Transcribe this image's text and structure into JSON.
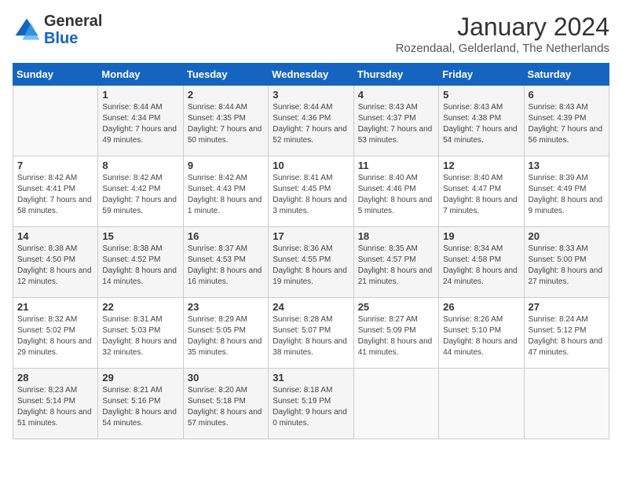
{
  "logo": {
    "general": "General",
    "blue": "Blue"
  },
  "header": {
    "month": "January 2024",
    "location": "Rozendaal, Gelderland, The Netherlands"
  },
  "days_of_week": [
    "Sunday",
    "Monday",
    "Tuesday",
    "Wednesday",
    "Thursday",
    "Friday",
    "Saturday"
  ],
  "weeks": [
    [
      {
        "day": "",
        "sunrise": "",
        "sunset": "",
        "daylight": ""
      },
      {
        "day": "1",
        "sunrise": "Sunrise: 8:44 AM",
        "sunset": "Sunset: 4:34 PM",
        "daylight": "Daylight: 7 hours and 49 minutes."
      },
      {
        "day": "2",
        "sunrise": "Sunrise: 8:44 AM",
        "sunset": "Sunset: 4:35 PM",
        "daylight": "Daylight: 7 hours and 50 minutes."
      },
      {
        "day": "3",
        "sunrise": "Sunrise: 8:44 AM",
        "sunset": "Sunset: 4:36 PM",
        "daylight": "Daylight: 7 hours and 52 minutes."
      },
      {
        "day": "4",
        "sunrise": "Sunrise: 8:43 AM",
        "sunset": "Sunset: 4:37 PM",
        "daylight": "Daylight: 7 hours and 53 minutes."
      },
      {
        "day": "5",
        "sunrise": "Sunrise: 8:43 AM",
        "sunset": "Sunset: 4:38 PM",
        "daylight": "Daylight: 7 hours and 54 minutes."
      },
      {
        "day": "6",
        "sunrise": "Sunrise: 8:43 AM",
        "sunset": "Sunset: 4:39 PM",
        "daylight": "Daylight: 7 hours and 56 minutes."
      }
    ],
    [
      {
        "day": "7",
        "sunrise": "Sunrise: 8:42 AM",
        "sunset": "Sunset: 4:41 PM",
        "daylight": "Daylight: 7 hours and 58 minutes."
      },
      {
        "day": "8",
        "sunrise": "Sunrise: 8:42 AM",
        "sunset": "Sunset: 4:42 PM",
        "daylight": "Daylight: 7 hours and 59 minutes."
      },
      {
        "day": "9",
        "sunrise": "Sunrise: 8:42 AM",
        "sunset": "Sunset: 4:43 PM",
        "daylight": "Daylight: 8 hours and 1 minute."
      },
      {
        "day": "10",
        "sunrise": "Sunrise: 8:41 AM",
        "sunset": "Sunset: 4:45 PM",
        "daylight": "Daylight: 8 hours and 3 minutes."
      },
      {
        "day": "11",
        "sunrise": "Sunrise: 8:40 AM",
        "sunset": "Sunset: 4:46 PM",
        "daylight": "Daylight: 8 hours and 5 minutes."
      },
      {
        "day": "12",
        "sunrise": "Sunrise: 8:40 AM",
        "sunset": "Sunset: 4:47 PM",
        "daylight": "Daylight: 8 hours and 7 minutes."
      },
      {
        "day": "13",
        "sunrise": "Sunrise: 8:39 AM",
        "sunset": "Sunset: 4:49 PM",
        "daylight": "Daylight: 8 hours and 9 minutes."
      }
    ],
    [
      {
        "day": "14",
        "sunrise": "Sunrise: 8:38 AM",
        "sunset": "Sunset: 4:50 PM",
        "daylight": "Daylight: 8 hours and 12 minutes."
      },
      {
        "day": "15",
        "sunrise": "Sunrise: 8:38 AM",
        "sunset": "Sunset: 4:52 PM",
        "daylight": "Daylight: 8 hours and 14 minutes."
      },
      {
        "day": "16",
        "sunrise": "Sunrise: 8:37 AM",
        "sunset": "Sunset: 4:53 PM",
        "daylight": "Daylight: 8 hours and 16 minutes."
      },
      {
        "day": "17",
        "sunrise": "Sunrise: 8:36 AM",
        "sunset": "Sunset: 4:55 PM",
        "daylight": "Daylight: 8 hours and 19 minutes."
      },
      {
        "day": "18",
        "sunrise": "Sunrise: 8:35 AM",
        "sunset": "Sunset: 4:57 PM",
        "daylight": "Daylight: 8 hours and 21 minutes."
      },
      {
        "day": "19",
        "sunrise": "Sunrise: 8:34 AM",
        "sunset": "Sunset: 4:58 PM",
        "daylight": "Daylight: 8 hours and 24 minutes."
      },
      {
        "day": "20",
        "sunrise": "Sunrise: 8:33 AM",
        "sunset": "Sunset: 5:00 PM",
        "daylight": "Daylight: 8 hours and 27 minutes."
      }
    ],
    [
      {
        "day": "21",
        "sunrise": "Sunrise: 8:32 AM",
        "sunset": "Sunset: 5:02 PM",
        "daylight": "Daylight: 8 hours and 29 minutes."
      },
      {
        "day": "22",
        "sunrise": "Sunrise: 8:31 AM",
        "sunset": "Sunset: 5:03 PM",
        "daylight": "Daylight: 8 hours and 32 minutes."
      },
      {
        "day": "23",
        "sunrise": "Sunrise: 8:29 AM",
        "sunset": "Sunset: 5:05 PM",
        "daylight": "Daylight: 8 hours and 35 minutes."
      },
      {
        "day": "24",
        "sunrise": "Sunrise: 8:28 AM",
        "sunset": "Sunset: 5:07 PM",
        "daylight": "Daylight: 8 hours and 38 minutes."
      },
      {
        "day": "25",
        "sunrise": "Sunrise: 8:27 AM",
        "sunset": "Sunset: 5:09 PM",
        "daylight": "Daylight: 8 hours and 41 minutes."
      },
      {
        "day": "26",
        "sunrise": "Sunrise: 8:26 AM",
        "sunset": "Sunset: 5:10 PM",
        "daylight": "Daylight: 8 hours and 44 minutes."
      },
      {
        "day": "27",
        "sunrise": "Sunrise: 8:24 AM",
        "sunset": "Sunset: 5:12 PM",
        "daylight": "Daylight: 8 hours and 47 minutes."
      }
    ],
    [
      {
        "day": "28",
        "sunrise": "Sunrise: 8:23 AM",
        "sunset": "Sunset: 5:14 PM",
        "daylight": "Daylight: 8 hours and 51 minutes."
      },
      {
        "day": "29",
        "sunrise": "Sunrise: 8:21 AM",
        "sunset": "Sunset: 5:16 PM",
        "daylight": "Daylight: 8 hours and 54 minutes."
      },
      {
        "day": "30",
        "sunrise": "Sunrise: 8:20 AM",
        "sunset": "Sunset: 5:18 PM",
        "daylight": "Daylight: 8 hours and 57 minutes."
      },
      {
        "day": "31",
        "sunrise": "Sunrise: 8:18 AM",
        "sunset": "Sunset: 5:19 PM",
        "daylight": "Daylight: 9 hours and 0 minutes."
      },
      {
        "day": "",
        "sunrise": "",
        "sunset": "",
        "daylight": ""
      },
      {
        "day": "",
        "sunrise": "",
        "sunset": "",
        "daylight": ""
      },
      {
        "day": "",
        "sunrise": "",
        "sunset": "",
        "daylight": ""
      }
    ]
  ]
}
